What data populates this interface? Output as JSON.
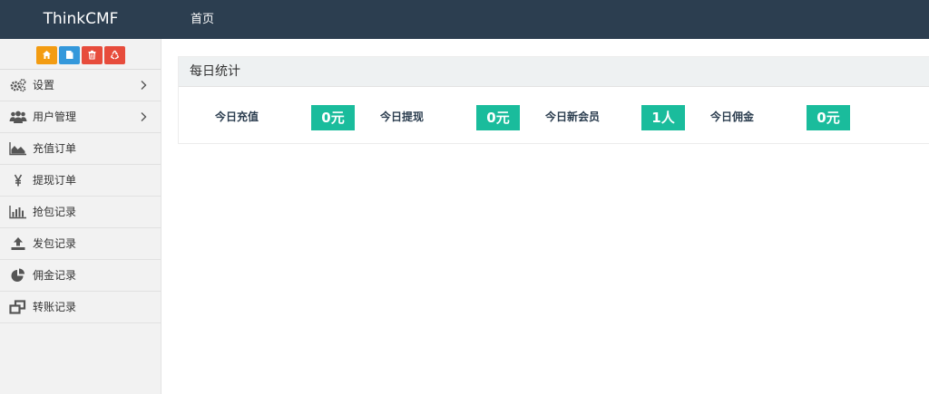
{
  "header": {
    "brand": "ThinkCMF",
    "nav_home": "首页"
  },
  "shortcuts": [
    {
      "icon": "home-icon",
      "color": "#f39c12"
    },
    {
      "icon": "file-icon",
      "color": "#3498db"
    },
    {
      "icon": "trash-icon",
      "color": "#e74c3c"
    },
    {
      "icon": "recycle-icon",
      "color": "#e74c3c"
    }
  ],
  "sidebar": {
    "items": [
      {
        "label": "设置",
        "icon": "gears-icon",
        "has_submenu": true
      },
      {
        "label": "用户管理",
        "icon": "users-icon",
        "has_submenu": true
      },
      {
        "label": "充值订单",
        "icon": "area-chart-icon",
        "has_submenu": false
      },
      {
        "label": "提现订单",
        "icon": "yen-icon",
        "has_submenu": false
      },
      {
        "label": "抢包记录",
        "icon": "bar-chart-icon",
        "has_submenu": false
      },
      {
        "label": "发包记录",
        "icon": "upload-icon",
        "has_submenu": false
      },
      {
        "label": "佣金记录",
        "icon": "pie-chart-icon",
        "has_submenu": false
      },
      {
        "label": "转账记录",
        "icon": "clone-icon",
        "has_submenu": false
      }
    ]
  },
  "stats_panel": {
    "title": "每日统计",
    "stats": [
      {
        "label": "今日充值",
        "value": "0元"
      },
      {
        "label": "今日提现",
        "value": "0元"
      },
      {
        "label": "今日新会员",
        "value": "1人"
      },
      {
        "label": "今日佣金",
        "value": "0元"
      }
    ]
  },
  "colors": {
    "topbar": "#2c3e50",
    "accent": "#1abc9c",
    "sidebar_bg": "#f2f2f2"
  }
}
